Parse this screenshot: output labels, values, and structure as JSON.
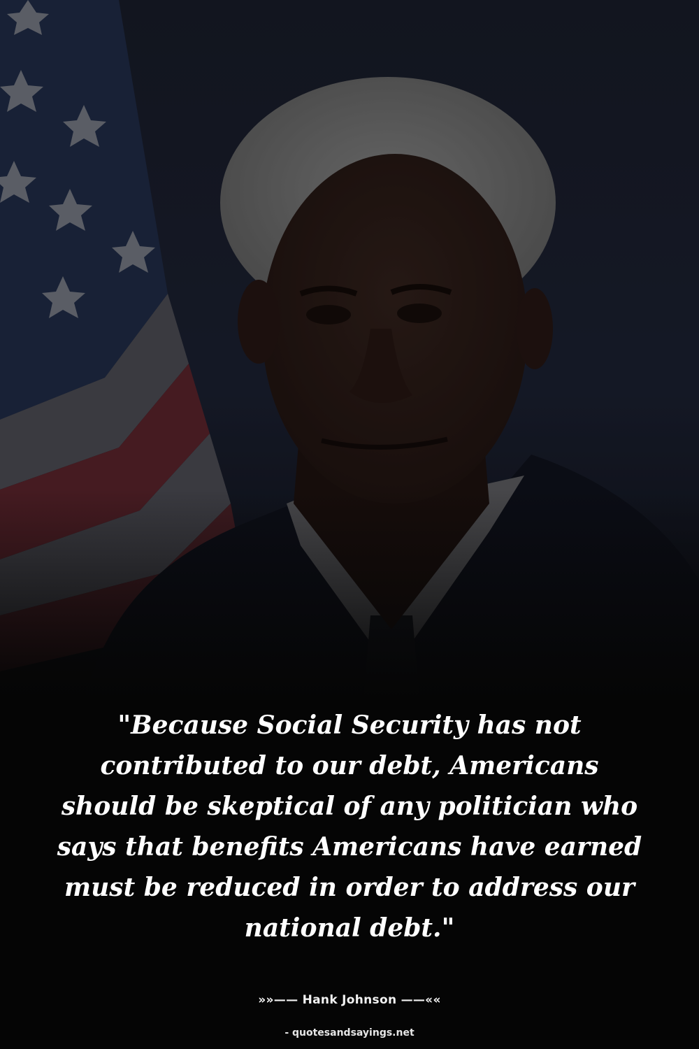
{
  "quote": {
    "text": "\"Because Social Security has not contributed to our debt, Americans should be skeptical of any politician who says that benefits Americans have earned must be reduced in order to address our national debt.\""
  },
  "attribution": {
    "author_line": "»»—— Hank Johnson ——««"
  },
  "footer": {
    "site": "- quotesandsayings.net"
  },
  "colors": {
    "background": "#050505",
    "text": "#ffffff"
  }
}
